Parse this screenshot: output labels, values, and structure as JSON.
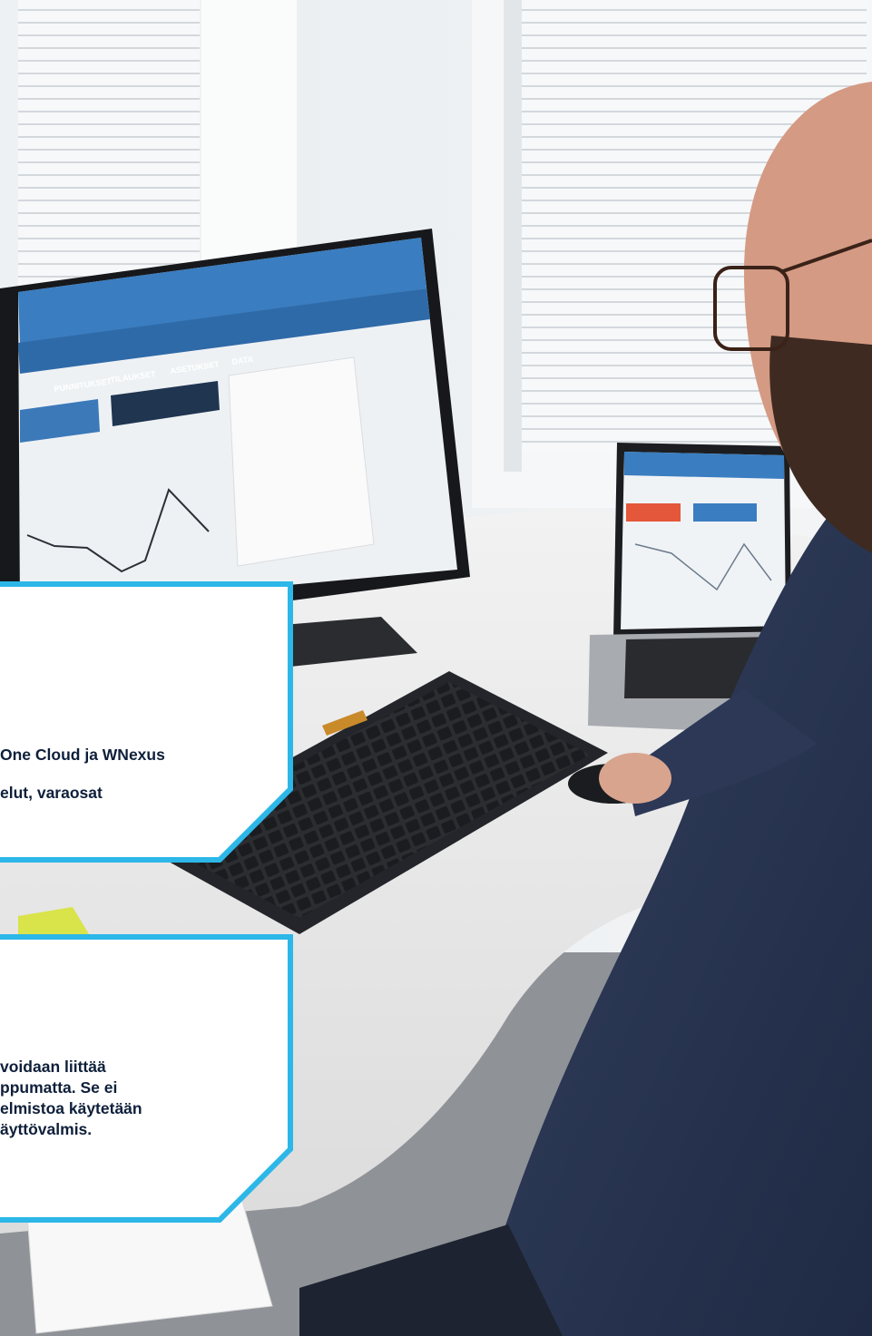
{
  "colors": {
    "card_border": "#2cb7e8",
    "card_text": "#0e1f3a",
    "card_bg": "#ffffff",
    "top_line": "#0f2a45"
  },
  "photo": {
    "description_items": [
      "window-blinds",
      "desktop-monitor",
      "laptop",
      "keyboard",
      "mouse",
      "sticky-note",
      "battery",
      "person-in-blue-shirt"
    ],
    "monitor_screen": {
      "nav_labels": [
        "PUNNITUKSET",
        "TILAUKSET",
        "ASETUKSET",
        "DATA"
      ]
    }
  },
  "cards": {
    "card1": {
      "line_a": "One Cloud ja WNexus",
      "line_b": "elut, varaosat"
    },
    "card2": {
      "lines": [
        "voidaan liittää",
        "ppumatta. Se ei",
        "elmistoa käytetään",
        "äyttövalmis."
      ]
    }
  }
}
